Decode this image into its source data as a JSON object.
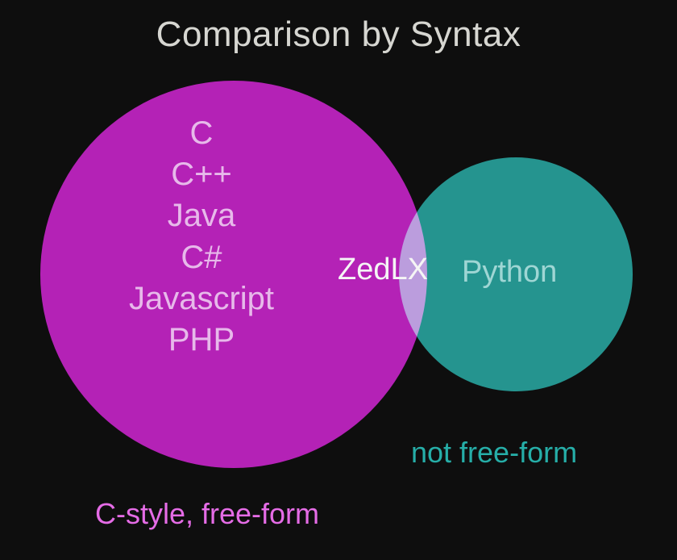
{
  "title": "Comparison by Syntax",
  "left_set": {
    "items": [
      "C",
      "C++",
      "Java",
      "C#",
      "Javascript",
      "PHP"
    ],
    "caption": "C-style, free-form",
    "color": "#b015b2"
  },
  "intersection": {
    "label": "ZedLX"
  },
  "right_set": {
    "item": "Python",
    "caption": "not free-form",
    "color": "#188e89"
  }
}
